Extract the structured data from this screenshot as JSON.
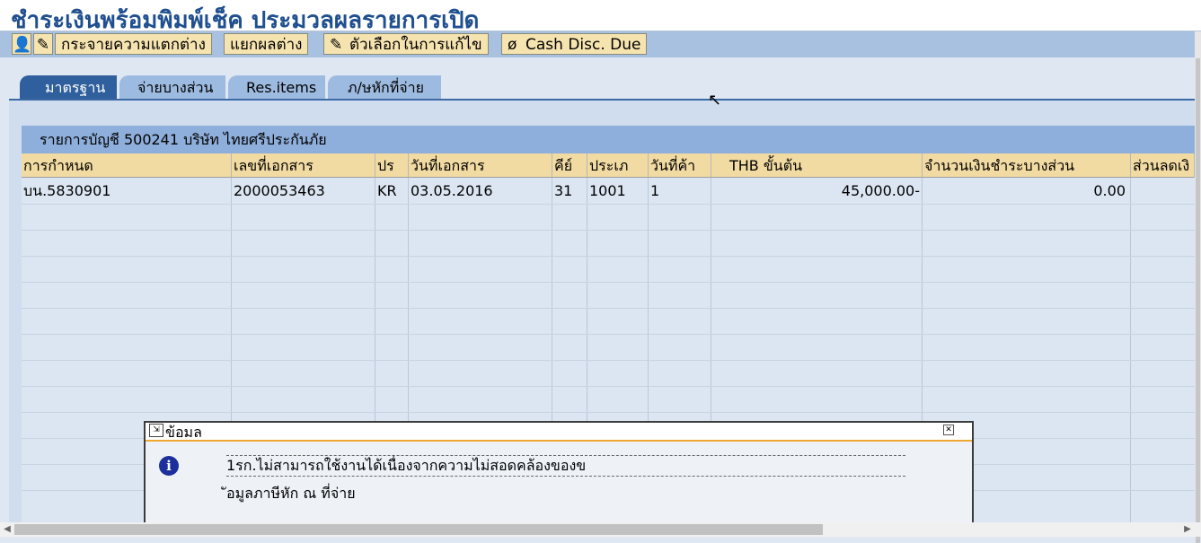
{
  "window": {
    "title": "ชำระเงินพร้อมพิมพ์เช็ค ประมวลผลรายการเปิด"
  },
  "toolbar": {
    "icon1": "person-icon",
    "icon2": "edit-icon",
    "btn_distribute": "กระจายความแตกต่าง",
    "btn_split": "แยกผลต่าง",
    "btn_edit_options": "ตัวเลือกในการแก้ไข",
    "btn_cash_disc": "Cash Disc. Due"
  },
  "tabs": [
    {
      "label": "มาตรฐาน",
      "active": true
    },
    {
      "label": "จ่ายบางส่วน",
      "active": false
    },
    {
      "label": "Res.items",
      "active": false
    },
    {
      "label": "ภ/ษหักที่จ่าย",
      "active": false
    }
  ],
  "table": {
    "title": "รายการบัญชี 500241 บริษัท ไทยศรีประกันภัย",
    "headers": [
      "การกำหนด",
      "เลขที่เอกสาร",
      "ปร",
      "วันที่เอกสาร",
      "คีย์",
      "ประเภ",
      "วันที่ค้า",
      "THB ขั้นต้น",
      "จำนวนเงินชำระบางส่วน",
      "ส่วนลดเงิ"
    ],
    "rows": [
      [
        "บน.5830901",
        "2000053463",
        "KR",
        "03.05.2016",
        "31",
        "1001",
        "1",
        "45,000.00-",
        "0.00",
        ""
      ]
    ]
  },
  "dialog": {
    "title": "ข้อมล",
    "line1": "1รก.ไม่สามารถใช้งานได้เนื่องจากความไม่สอดคล้องของข",
    "line2": "ัอมูลภาษีหัก ณ ที่จ่าย"
  }
}
